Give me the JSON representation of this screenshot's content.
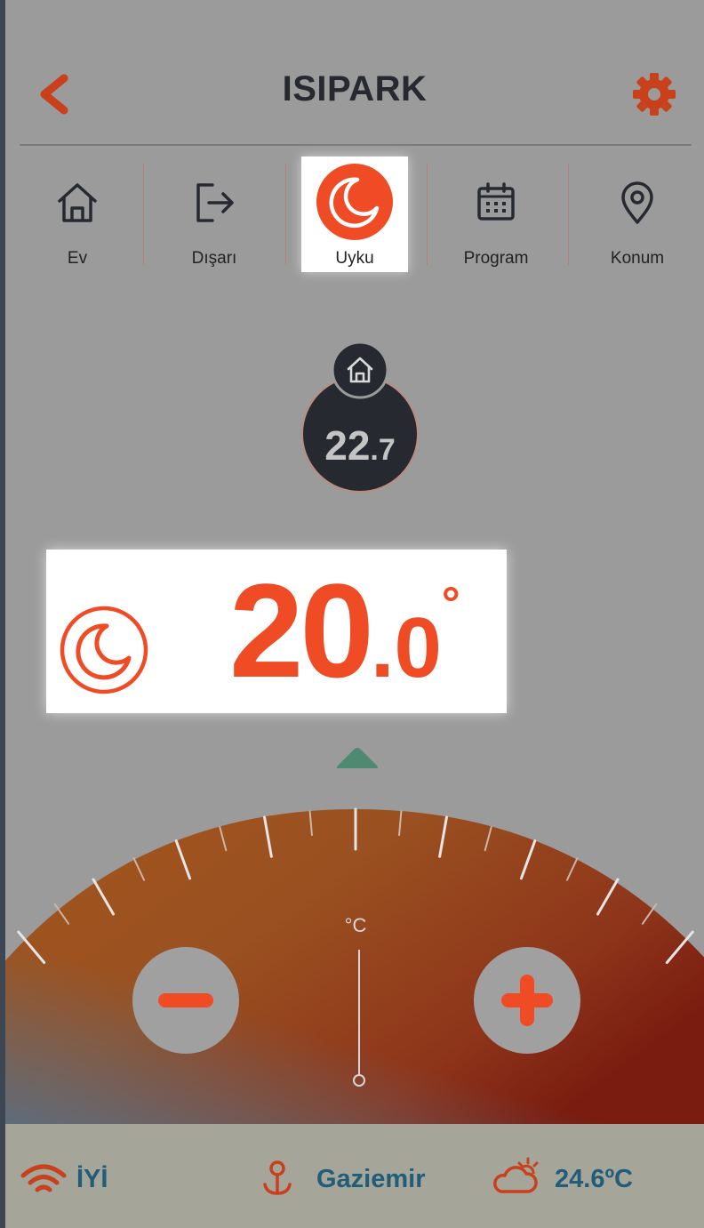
{
  "header": {
    "title": "ISIPARK",
    "back_icon": "chevron-left-icon",
    "settings_icon": "gear-icon"
  },
  "tabs": [
    {
      "label": "Ev",
      "icon": "home-icon",
      "active": false
    },
    {
      "label": "Dışarı",
      "icon": "logout-icon",
      "active": false
    },
    {
      "label": "Uyku",
      "icon": "moon-icon",
      "active": true
    },
    {
      "label": "Program",
      "icon": "calendar-icon",
      "active": false
    },
    {
      "label": "Konum",
      "icon": "location-pin-icon",
      "active": false
    }
  ],
  "current_temp": {
    "int": "22",
    "dec": ".7",
    "icon": "home-icon"
  },
  "setpoint": {
    "int": "20",
    "dec": ".0",
    "deg": "°",
    "icon": "moon-icon"
  },
  "dial": {
    "unit": "°C",
    "minus_icon": "minus-icon",
    "plus_icon": "plus-icon"
  },
  "footer": {
    "wifi_status": "İYİ",
    "location": "Gaziemir",
    "weather_temp": "24.6ºC",
    "wifi_icon": "wifi-icon",
    "location_icon": "location-anchor-icon",
    "weather_icon": "partly-sunny-icon"
  },
  "colors": {
    "accent": "#ef4b24",
    "dark": "#262a30",
    "footer_text": "#215d78",
    "pointer": "#4e8a72"
  }
}
